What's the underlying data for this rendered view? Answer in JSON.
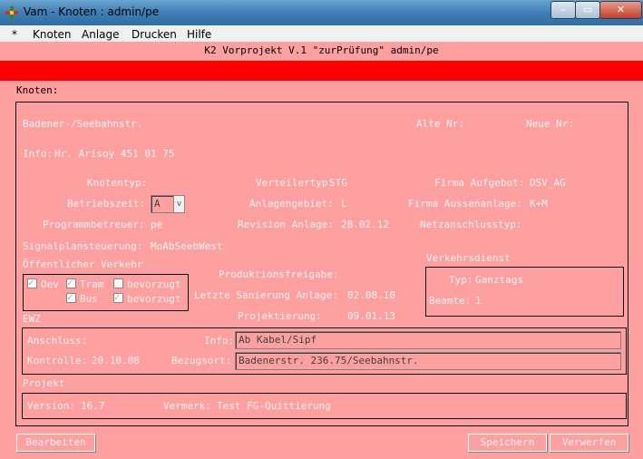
{
  "window": {
    "title": "Vam - Knoten : admin/pe",
    "min": "–",
    "max": "▭",
    "close": "✕"
  },
  "menu": [
    "*",
    "Knoten",
    "Anlage",
    "Drucken",
    "Hilfe"
  ],
  "header": "K2 Vorprojekt V.1 \"zurPrüfung\" admin/pe",
  "section_label": "Knoten:",
  "knoten": {
    "name": "Badener-/Seebahnstr.",
    "alte_nr": "Alte Nr:",
    "neue_nr": "Neue Nr:",
    "info_label": "Info:",
    "info_value": "Hr. Arisoy 451 01 75",
    "knotentyp_label": "Knotentyp:",
    "verteilertyp_label": "Verteilertyp:",
    "verteilertyp_value": "STG",
    "firma_aufgebot_label": "Firma Aufgebot:",
    "firma_aufgebot_value": "DSV_AG",
    "betriebszeit_label": "Betriebszeit:",
    "betriebszeit_value": "A",
    "anlagengebiet_label": "Anlagengebiet:",
    "anlagengebiet_value": "L",
    "firma_aussen_label": "Firma Aussenanlage:",
    "firma_aussen_value": "K+M",
    "programmbetreuer_label": "Programmbetreuer:",
    "programmbetreuer_value": "pe",
    "revision_label": "Revision Anlage:",
    "revision_value": "28.02.12",
    "netzanschluss_label": "Netzanschlusstyp:",
    "signalplan_label": "Signalplansteuerung:",
    "signalplan_value": "MoAbSeebWest",
    "oev_label": "Öffentlicher Verkehr",
    "cb_oev": "Oev",
    "cb_tram": "Tram",
    "cb_bev1": "bevorzugt",
    "cb_bus": "Bus",
    "cb_bev2": "bevorzugt",
    "produktion_label": "Produktionsfreigabe:",
    "sanierung_label": "Letzte Sanierung Anlage:",
    "sanierung_value": "02.08.10",
    "projektierung_label": "Projektierung:",
    "projektierung_value": "09.01.13",
    "verkehrsdienst_label": "Verkehrsdienst",
    "typ_label": "Typ:",
    "typ_value": "Ganztags",
    "beamte_label": "Beamte:",
    "beamte_value": "1"
  },
  "ewz": {
    "label": "EWZ",
    "anschluss_label": "Anschluss:",
    "info_label": "Info:",
    "info_value": "Ab Kabel/Sipf",
    "kontrolle_label": "Kontrolle:",
    "kontrolle_value": "20.10.08",
    "bezugsort_label": "Bezugsort:",
    "bezugsort_value": "Badenerstr. 236.75/Seebahnstr."
  },
  "projekt": {
    "label": "Projekt",
    "version_label": "Version:",
    "version_value": "16.7",
    "vermerk_label": "Vermerk:",
    "vermerk_value": "Test FG-Quittierung"
  },
  "buttons": {
    "bearbeiten": "Bearbeiten",
    "speichern": "Speichern",
    "verwerfen": "Verwerfen"
  }
}
